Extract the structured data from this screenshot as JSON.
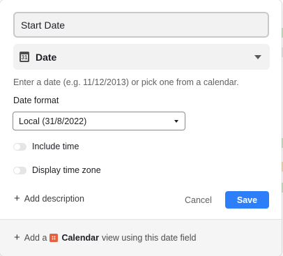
{
  "field_name": "Start Date",
  "field_type": {
    "icon": "calendar-icon",
    "icon_text": "31",
    "label": "Date"
  },
  "hint": "Enter a date (e.g. 11/12/2013) or pick one from a calendar.",
  "date_format": {
    "label": "Date format",
    "selected": "Local (31/8/2022)"
  },
  "toggles": {
    "include_time": "Include time",
    "display_time_zone": "Display time zone"
  },
  "actions": {
    "add_description": "Add description",
    "cancel": "Cancel",
    "save": "Save"
  },
  "footer": {
    "prefix": "Add a",
    "view_name": "Calendar",
    "suffix": "view using this date field"
  },
  "colors": {
    "accent": "#2d7ff9",
    "calendar_icon": "#e8613d"
  }
}
